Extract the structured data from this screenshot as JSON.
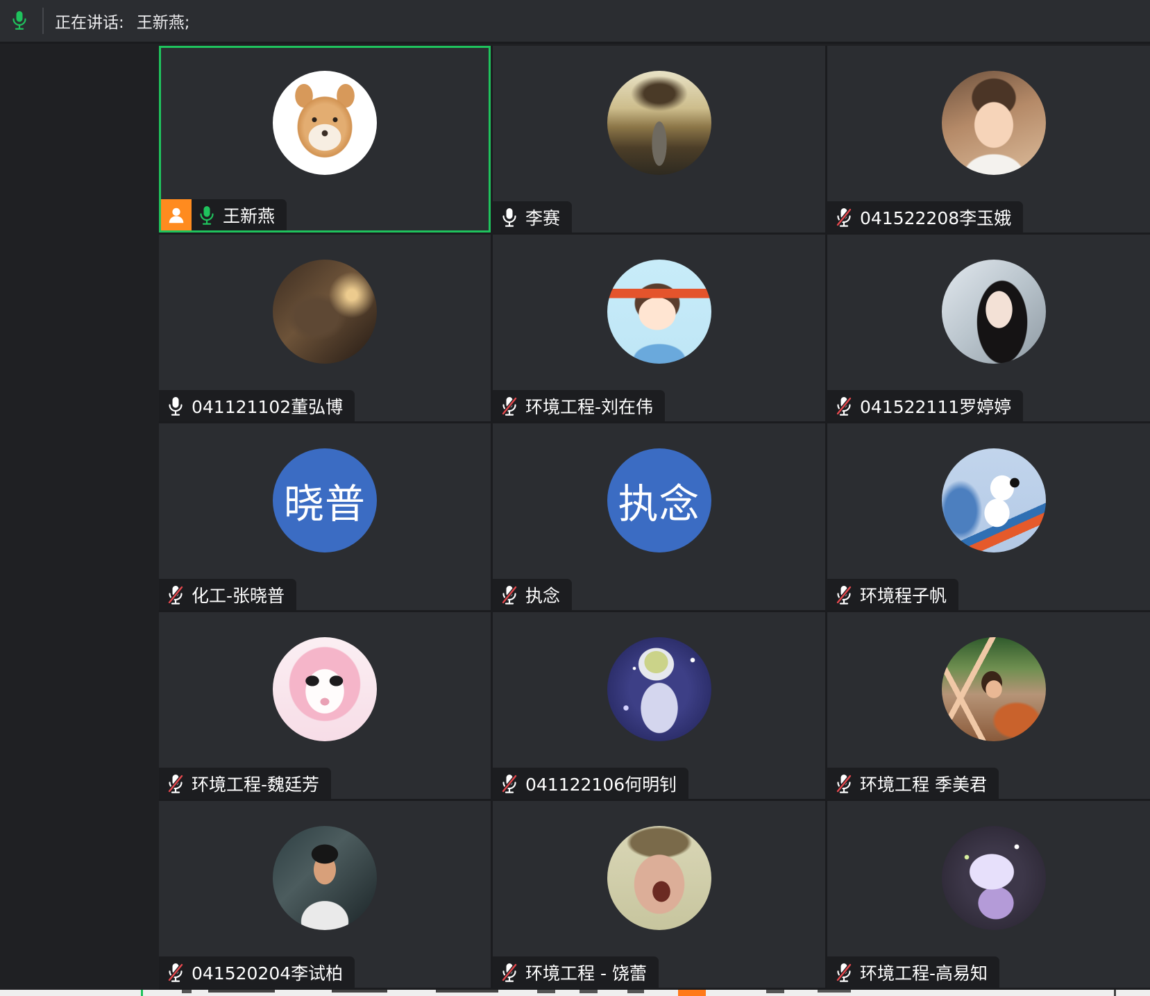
{
  "speaking_bar": {
    "mic_icon": "mic-active-icon",
    "label": "正在讲话:",
    "speakers": "王新燕;"
  },
  "colors": {
    "accent_green": "#1fc35d",
    "host_orange": "#ff8b1f",
    "muted_red": "#e5484d",
    "text_avatar_blue": "#3b6cc3"
  },
  "participants": [
    {
      "name": "王新燕",
      "mic_icon": "mic-active-icon",
      "host_icon": "host-icon",
      "active": true
    },
    {
      "name": "李赛",
      "mic_icon": "mic-icon"
    },
    {
      "name": "041522208李玉娥",
      "mic_icon": "mic-muted-icon"
    },
    {
      "name": "041121102董弘博",
      "mic_icon": "mic-icon"
    },
    {
      "name": "环境工程-刘在伟",
      "mic_icon": "mic-muted-icon"
    },
    {
      "name": "041522111罗婷婷",
      "mic_icon": "mic-muted-icon"
    },
    {
      "name": "化工-张晓普",
      "mic_icon": "mic-muted-icon",
      "avatar_text": "晓普",
      "avatar_bg": "#3b6cc3"
    },
    {
      "name": "执念",
      "mic_icon": "mic-muted-icon",
      "avatar_text": "执念",
      "avatar_bg": "#3b6cc3"
    },
    {
      "name": "环境程子帆",
      "mic_icon": "mic-muted-icon"
    },
    {
      "name": "环境工程-魏廷芳",
      "mic_icon": "mic-muted-icon"
    },
    {
      "name": "041122106何明钊",
      "mic_icon": "mic-muted-icon"
    },
    {
      "name": "环境工程 季美君",
      "mic_icon": "mic-muted-icon"
    },
    {
      "name": "041520204李试柏",
      "mic_icon": "mic-muted-icon"
    },
    {
      "name": "环境工程 - 饶蕾",
      "mic_icon": "mic-muted-icon"
    },
    {
      "name": "环境工程-高易知",
      "mic_icon": "mic-muted-icon"
    }
  ]
}
